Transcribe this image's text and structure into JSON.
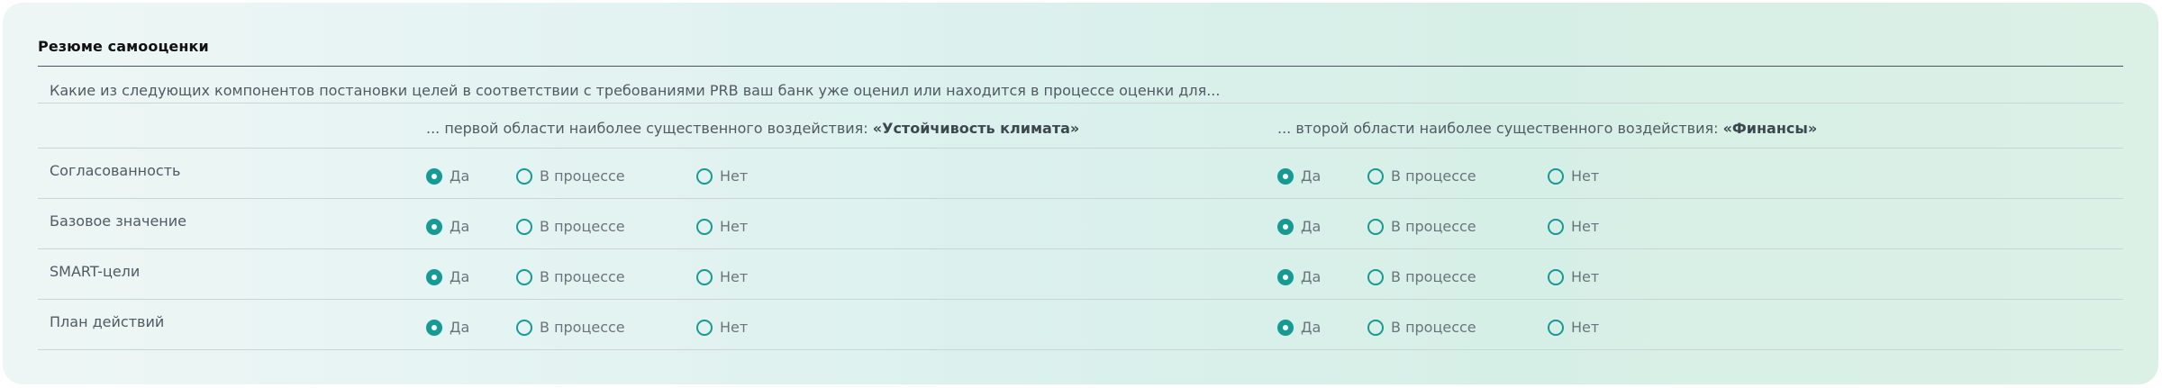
{
  "section": {
    "title": "Резюме самооценки",
    "question": "Какие из следующих компонентов постановки целей в соответствии с требованиями PRB ваш банк уже оценил или находится в процессе оценки для..."
  },
  "columns": [
    {
      "prefix": "... первой области наиболее существенного воздействия: ",
      "emphasis": "«Устойчивость климата»"
    },
    {
      "prefix": "... второй области наиболее существенного воздействия: ",
      "emphasis": "«Финансы»"
    }
  ],
  "options": [
    "Да",
    "В процессе",
    "Нет"
  ],
  "rows": [
    {
      "label": "Согласованность",
      "selected": [
        "Да",
        "Да"
      ]
    },
    {
      "label": "Базовое значение",
      "selected": [
        "Да",
        "Да"
      ]
    },
    {
      "label": "SMART-цели",
      "selected": [
        "Да",
        "Да"
      ]
    },
    {
      "label": "План действий",
      "selected": [
        "Да",
        "Да"
      ]
    }
  ],
  "colors": {
    "accent": "#169a94",
    "text": "#505a62"
  }
}
